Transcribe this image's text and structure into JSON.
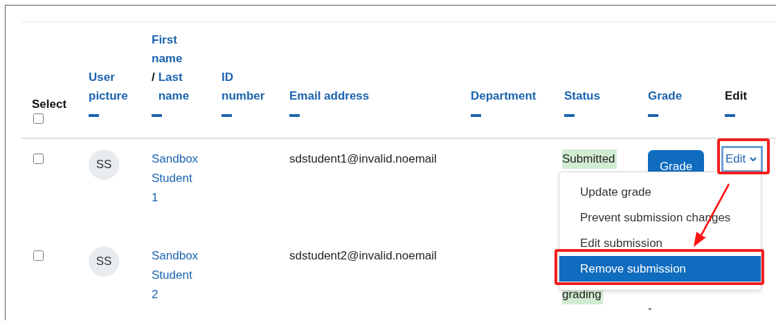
{
  "table": {
    "select_all": {
      "label": "Select",
      "checked": false
    },
    "columns": [
      {
        "kind": "link",
        "label": "User picture"
      },
      {
        "kind": "name",
        "first": "First name",
        "separator": "/",
        "last": "Last name"
      },
      {
        "kind": "link",
        "label": "ID number"
      },
      {
        "kind": "link",
        "label": "Email address"
      },
      {
        "kind": "link",
        "label": "Department"
      },
      {
        "kind": "link",
        "label": "Status"
      },
      {
        "kind": "link",
        "label": "Grade"
      },
      {
        "kind": "plain",
        "label": "Edit"
      }
    ],
    "rows": [
      {
        "checked": false,
        "initials": "SS",
        "name": "Sandbox Student 1",
        "email": "sdstudent1@invalid.noemail",
        "status": "Submitted",
        "grade": {
          "kind": "button",
          "label": "Grade"
        },
        "edit": "Edit"
      },
      {
        "checked": false,
        "initials": "SS",
        "name": "Sandbox Student 2",
        "email": "sdstudent2@invalid.noemail",
        "status": "grading",
        "grade": {
          "kind": "text",
          "label": "-"
        }
      }
    ]
  },
  "menu": {
    "items": [
      {
        "label": "Update grade",
        "selected": false
      },
      {
        "label": "Prevent submission changes",
        "selected": false
      },
      {
        "label": "Edit submission",
        "selected": false
      },
      {
        "label": "Remove submission",
        "selected": true
      }
    ]
  }
}
